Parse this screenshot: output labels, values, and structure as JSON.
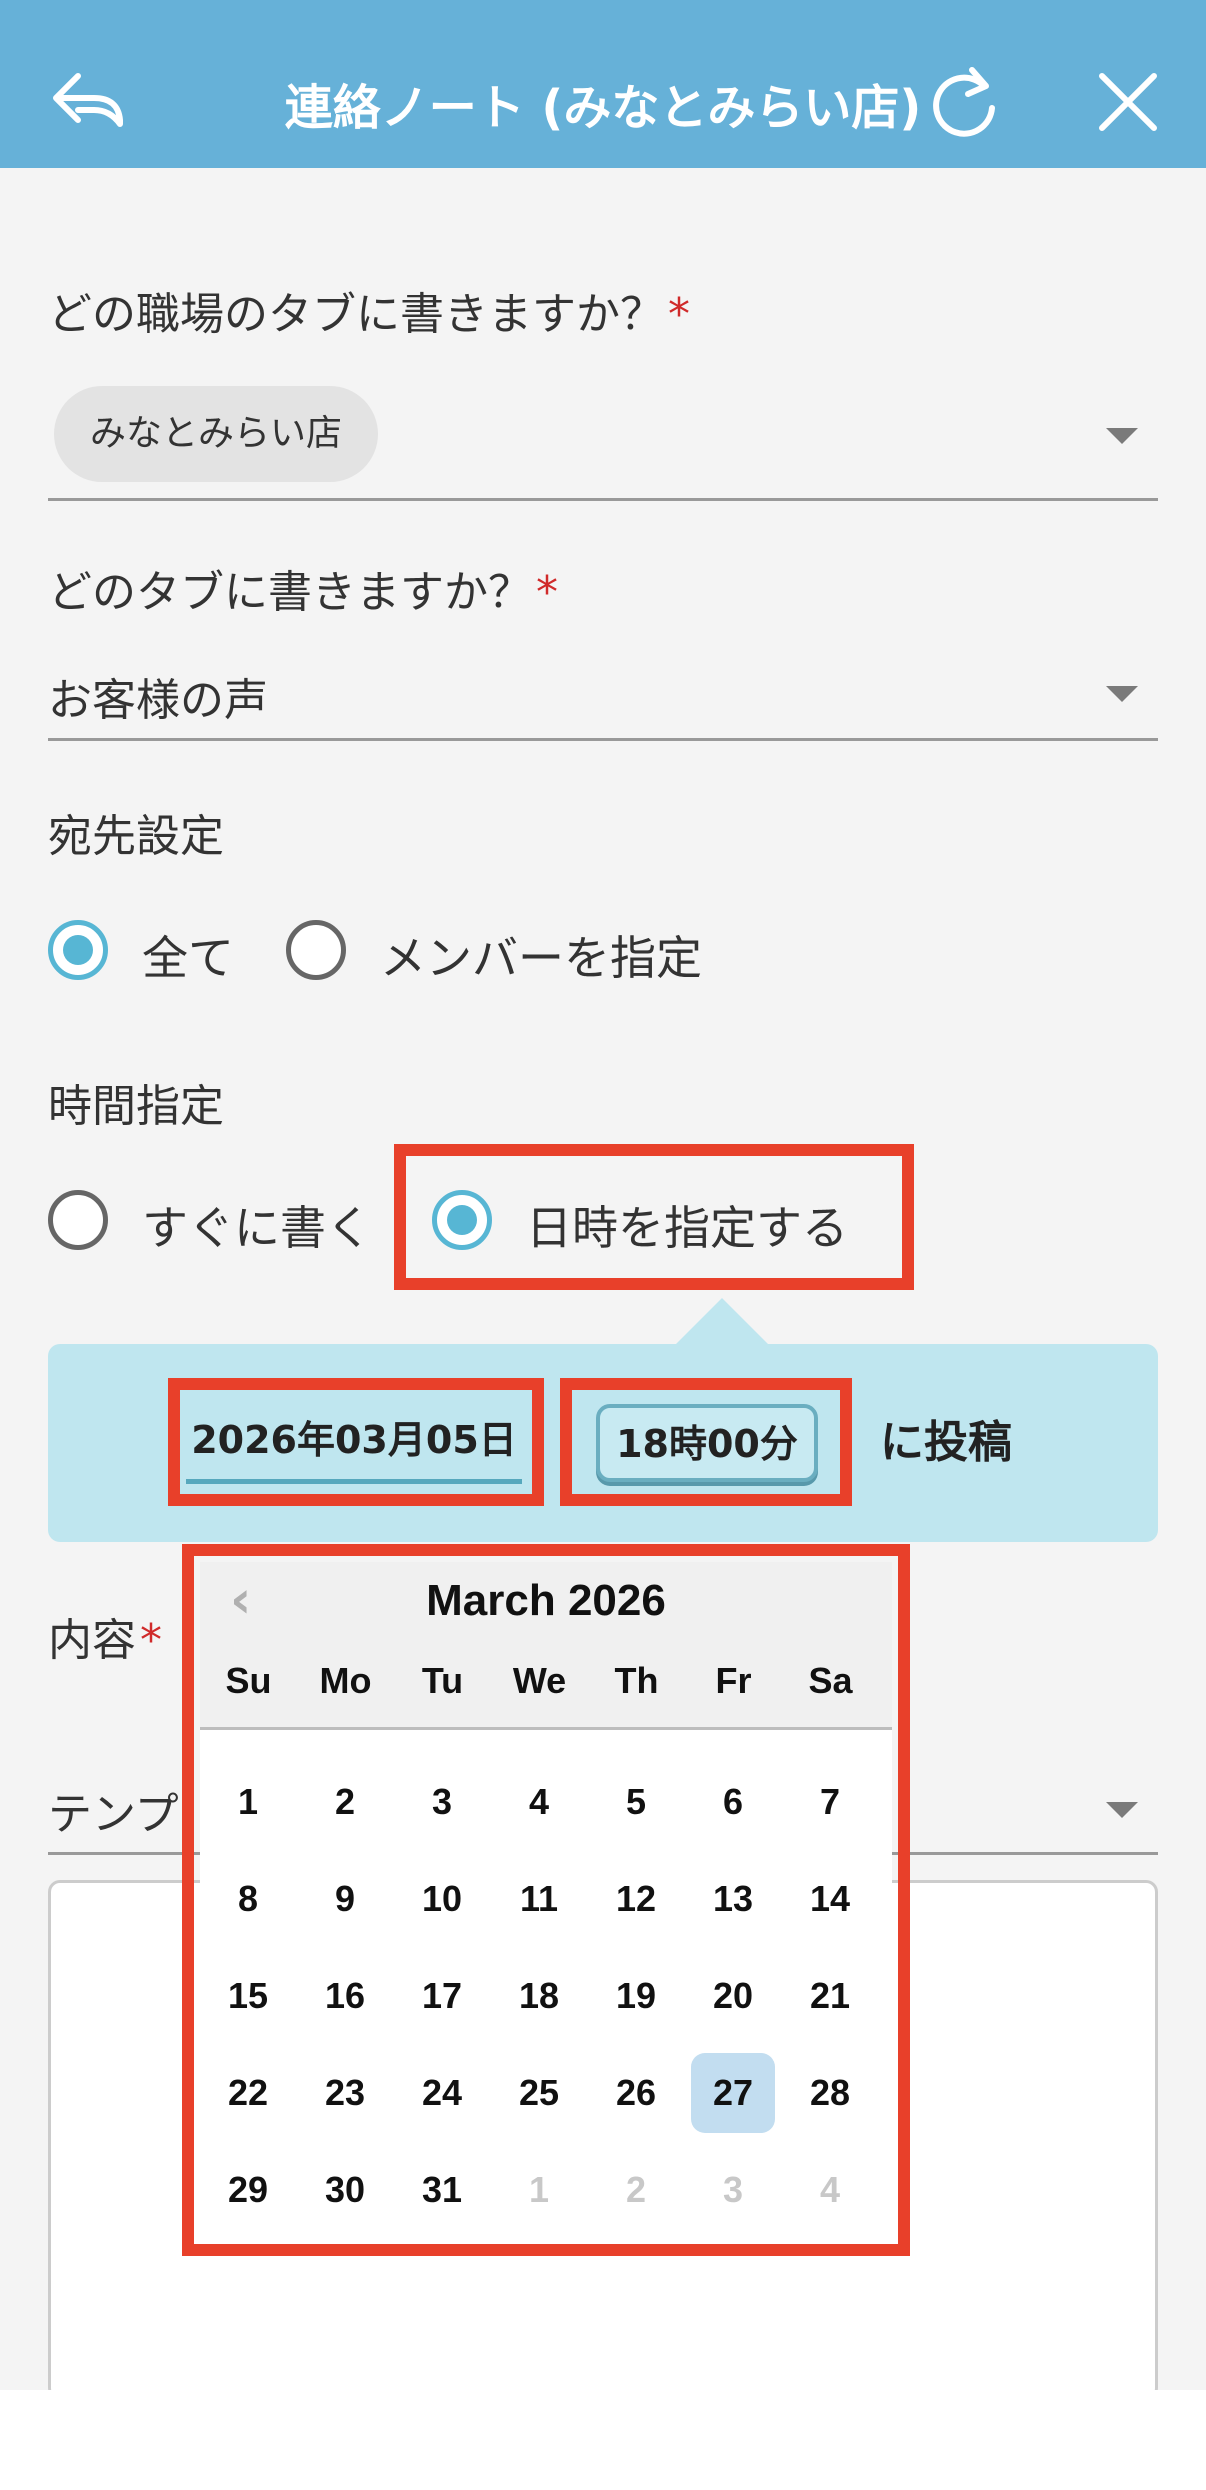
{
  "header": {
    "title": "連絡ノート (みなとみらい店)",
    "back_icon": "back-arrow-icon",
    "refresh_icon": "refresh-icon",
    "close_icon": "close-icon",
    "color": "#66b1d8"
  },
  "form": {
    "workplace_question": "どの職場のタブに書きますか？",
    "workplace_value": "みなとみらい店",
    "tab_question": "どのタブに書きますか？",
    "tab_value": "お客様の声",
    "required_mark": "*",
    "recipient_label": "宛先設定",
    "recipient_options": [
      {
        "label": "全て",
        "selected": true
      },
      {
        "label": "メンバーを指定",
        "selected": false
      }
    ],
    "time_label": "時間指定",
    "time_options": [
      {
        "label": "すぐに書く",
        "selected": false
      },
      {
        "label": "日時を指定する",
        "selected": true
      }
    ],
    "schedule": {
      "date": "2026年03月05日",
      "time": "18時00分",
      "suffix": "に投稿"
    },
    "content_label": "内容",
    "template_placeholder": "テンプ"
  },
  "calendar": {
    "title": "March 2026",
    "prev_icon": "chevron-left-icon",
    "weekdays": [
      "Su",
      "Mo",
      "Tu",
      "We",
      "Th",
      "Fr",
      "Sa"
    ],
    "weeks": [
      [
        "1",
        "2",
        "3",
        "4",
        "5",
        "6",
        "7"
      ],
      [
        "8",
        "9",
        "10",
        "11",
        "12",
        "13",
        "14"
      ],
      [
        "15",
        "16",
        "17",
        "18",
        "19",
        "20",
        "21"
      ],
      [
        "22",
        "23",
        "24",
        "25",
        "26",
        "27",
        "28"
      ],
      [
        "29",
        "30",
        "31",
        "1",
        "2",
        "3",
        "4"
      ]
    ],
    "highlighted_day": "27",
    "highlight_color": "#c2ddf0"
  },
  "annotation_color": "#e8402a"
}
